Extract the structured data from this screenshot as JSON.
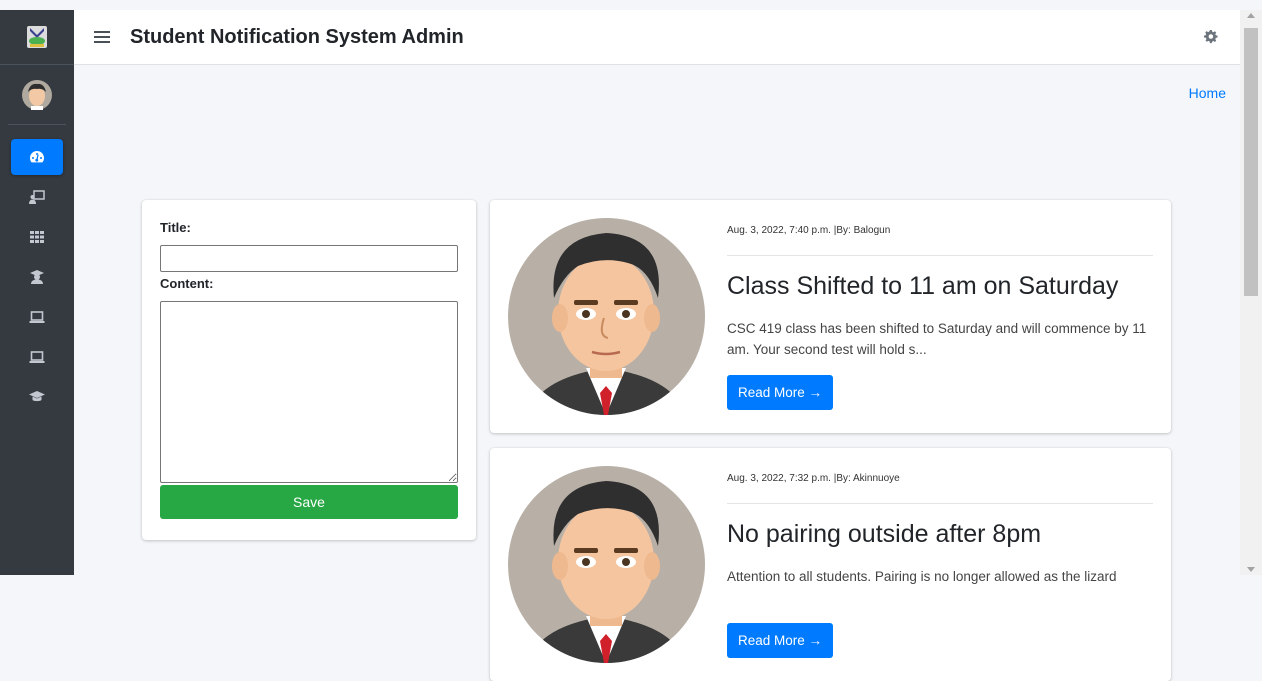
{
  "topbar": {
    "title": "Student Notification System Admin"
  },
  "breadcrumb": {
    "home": "Home"
  },
  "sidebar": {
    "items": [
      {
        "icon": "dashboard-icon",
        "active": true
      },
      {
        "icon": "chalkboard-teacher-icon",
        "active": false
      },
      {
        "icon": "grid-icon",
        "active": false
      },
      {
        "icon": "user-graduate-icon",
        "active": false
      },
      {
        "icon": "laptop-icon",
        "active": false
      },
      {
        "icon": "laptop-icon",
        "active": false
      },
      {
        "icon": "graduation-cap-icon",
        "active": false
      }
    ]
  },
  "form": {
    "title_label": "Title:",
    "title_value": "",
    "content_label": "Content:",
    "content_value": "",
    "save_label": "Save"
  },
  "posts": [
    {
      "meta": "Aug. 3, 2022, 7:40 p.m.  |By: Balogun",
      "title": "Class Shifted to 11 am on Saturday",
      "excerpt": "CSC 419 class has been shifted to Saturday and will commence by 11 am. Your second test will hold s...",
      "read_more": "Read More →"
    },
    {
      "meta": "Aug. 3, 2022, 7:32 p.m.  |By: Akinnuoye",
      "title": "No pairing outside after 8pm",
      "excerpt": "Attention to all students. Pairing is no longer allowed as the lizard",
      "read_more": "Read More →"
    }
  ],
  "colors": {
    "primary": "#007bff",
    "success": "#28a745",
    "sidebar": "#343a40"
  }
}
